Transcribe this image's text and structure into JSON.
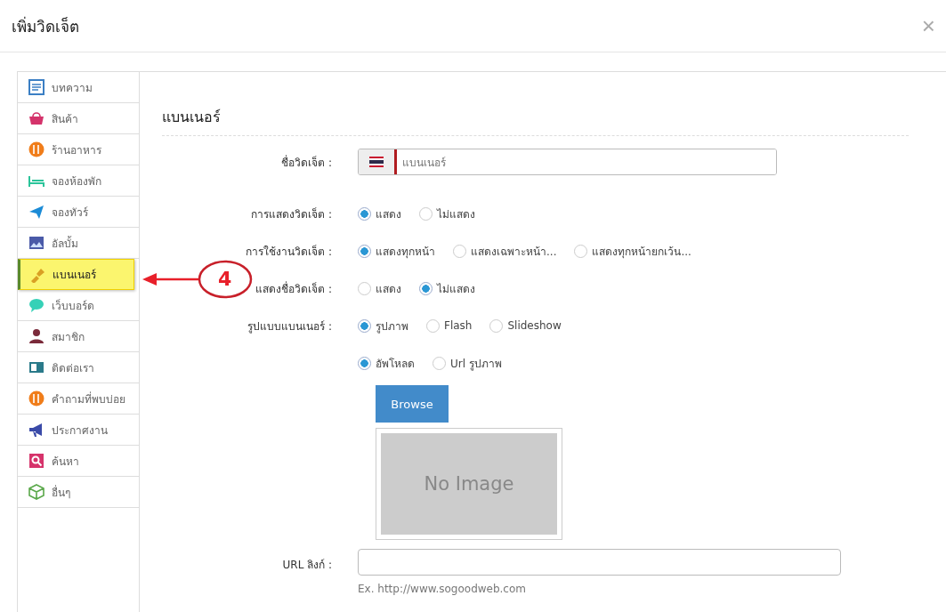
{
  "dialog": {
    "title": "เพิ่มวิดเจ็ต",
    "close": "×"
  },
  "sidebar": {
    "items": [
      {
        "label": "บทความ",
        "selected": false
      },
      {
        "label": "สินค้า",
        "selected": false
      },
      {
        "label": "ร้านอาหาร",
        "selected": false
      },
      {
        "label": "จองห้องพัก",
        "selected": false
      },
      {
        "label": "จองทัวร์",
        "selected": false
      },
      {
        "label": "อัลบั้ม",
        "selected": false
      },
      {
        "label": "แบนเนอร์",
        "selected": true
      },
      {
        "label": "เว็บบอร์ด",
        "selected": false
      },
      {
        "label": "สมาชิก",
        "selected": false
      },
      {
        "label": "ติดต่อเรา",
        "selected": false
      },
      {
        "label": "คำถามที่พบบ่อย",
        "selected": false
      },
      {
        "label": "ประกาศงาน",
        "selected": false
      },
      {
        "label": "ค้นหา",
        "selected": false
      },
      {
        "label": "อื่นๆ",
        "selected": false
      }
    ]
  },
  "panel": {
    "heading": "แบนเนอร์",
    "rows": [
      {
        "kind": "name",
        "label": "ชื่อวิดเจ็ต :",
        "value": "แบนเนอร์"
      },
      {
        "kind": "radio",
        "label": "การแสดงวิดเจ็ต :",
        "options": [
          {
            "label": "แสดง",
            "selected": true
          },
          {
            "label": "ไม่แสดง",
            "selected": false
          }
        ]
      },
      {
        "kind": "radio",
        "label": "การใช้งานวิดเจ็ต :",
        "options": [
          {
            "label": "แสดงทุกหน้า",
            "selected": true
          },
          {
            "label": "แสดงเฉพาะหน้า...",
            "selected": false
          },
          {
            "label": "แสดงทุกหน้ายกเว้น...",
            "selected": false
          }
        ]
      },
      {
        "kind": "radio",
        "label": "แสดงชื่อวิดเจ็ต :",
        "options": [
          {
            "label": "แสดง",
            "selected": false
          },
          {
            "label": "ไม่แสดง",
            "selected": true
          }
        ]
      },
      {
        "kind": "radio",
        "label": "รูปแบบแบนเนอร์ :",
        "options": [
          {
            "label": "รูปภาพ",
            "selected": true
          },
          {
            "label": "Flash",
            "selected": false
          },
          {
            "label": "Slideshow",
            "selected": false
          }
        ]
      },
      {
        "kind": "radio",
        "options": [
          {
            "label": "อัพโหลด",
            "selected": true
          },
          {
            "label": "Url รูปภาพ",
            "selected": false
          }
        ]
      },
      {
        "kind": "upload",
        "button": "Browse",
        "image": "No Image"
      },
      {
        "kind": "url",
        "label": "URL ลิงก์ :",
        "hint": "Ex. http://www.sogoodweb.com"
      }
    ]
  },
  "annotation": {
    "number": "4"
  }
}
